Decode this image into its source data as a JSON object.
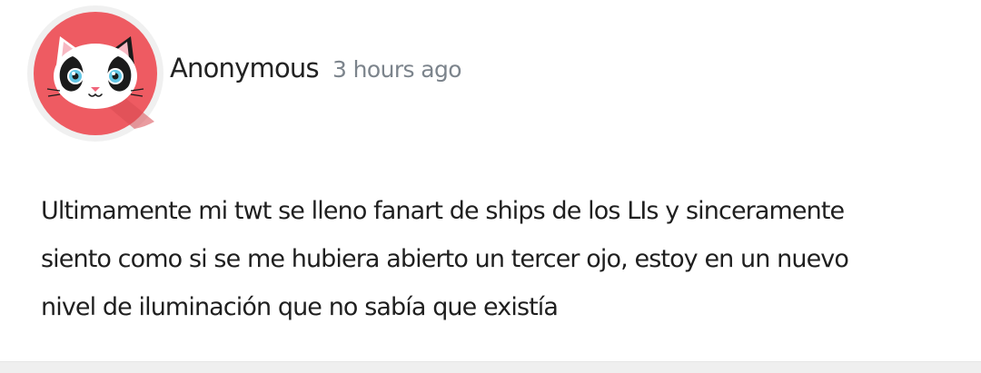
{
  "post": {
    "author": "Anonymous",
    "time": "3 hours ago",
    "message_lines": [
      "Ultimamente mi twt se lleno fanart de ships de los LIs y sinceramente",
      "siento como si se me hubiera abierto un tercer ojo, estoy en un nuevo",
      "nivel de iluminación que no sabía que existía"
    ]
  },
  "avatar": {
    "icon": "cat-avatar-icon",
    "colors": {
      "ring": "#f0f0f0",
      "background": "#ee5b62",
      "shadow": "#d94a52",
      "face": "#ffffff",
      "patch": "#1b1b1b",
      "eye": "#64c7e6",
      "nose": "#f0647a",
      "ear_inner": "#f7b8c2"
    }
  },
  "colors": {
    "text": "#1f1f1f",
    "muted": "#7c848c",
    "divider": "#efefef"
  }
}
